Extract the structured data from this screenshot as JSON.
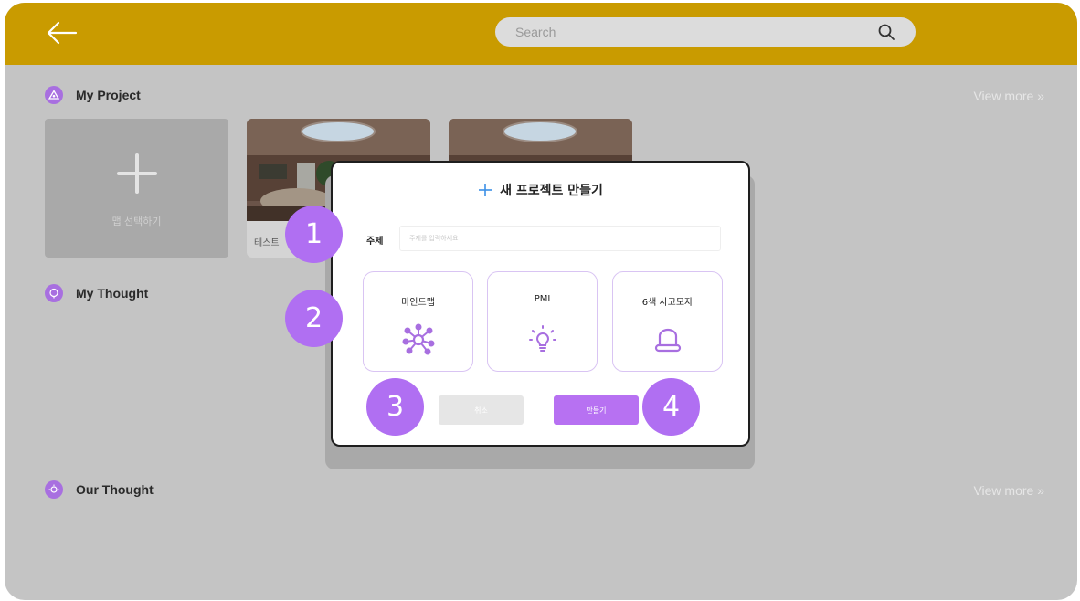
{
  "header": {
    "search_placeholder": "Search"
  },
  "sections": {
    "my_project": {
      "title": "My Project",
      "view_more": "View more  »"
    },
    "my_thought": {
      "title": "My Thought"
    },
    "our_thought": {
      "title": "Our Thought",
      "view_more": "View more  »"
    }
  },
  "projects": {
    "add_label": "맵 선택하기",
    "items": [
      {
        "label": "테스트"
      },
      {
        "label": ""
      }
    ]
  },
  "modal": {
    "title": "새 프로젝트 만들기",
    "topic_label": "주제",
    "topic_placeholder": "주제를 입력하세요",
    "tools": [
      {
        "label": "마인드맵",
        "icon": "mindmap-icon"
      },
      {
        "label": "PMI",
        "icon": "lightbulb-icon"
      },
      {
        "label": "6색 사고모자",
        "icon": "hat-icon"
      }
    ],
    "cancel_label": "취소",
    "create_label": "만들기"
  },
  "badges": [
    "1",
    "2",
    "3",
    "4"
  ],
  "colors": {
    "topbar": "#c99b00",
    "accent": "#b771f2",
    "overlay": "#c4c4c4"
  }
}
